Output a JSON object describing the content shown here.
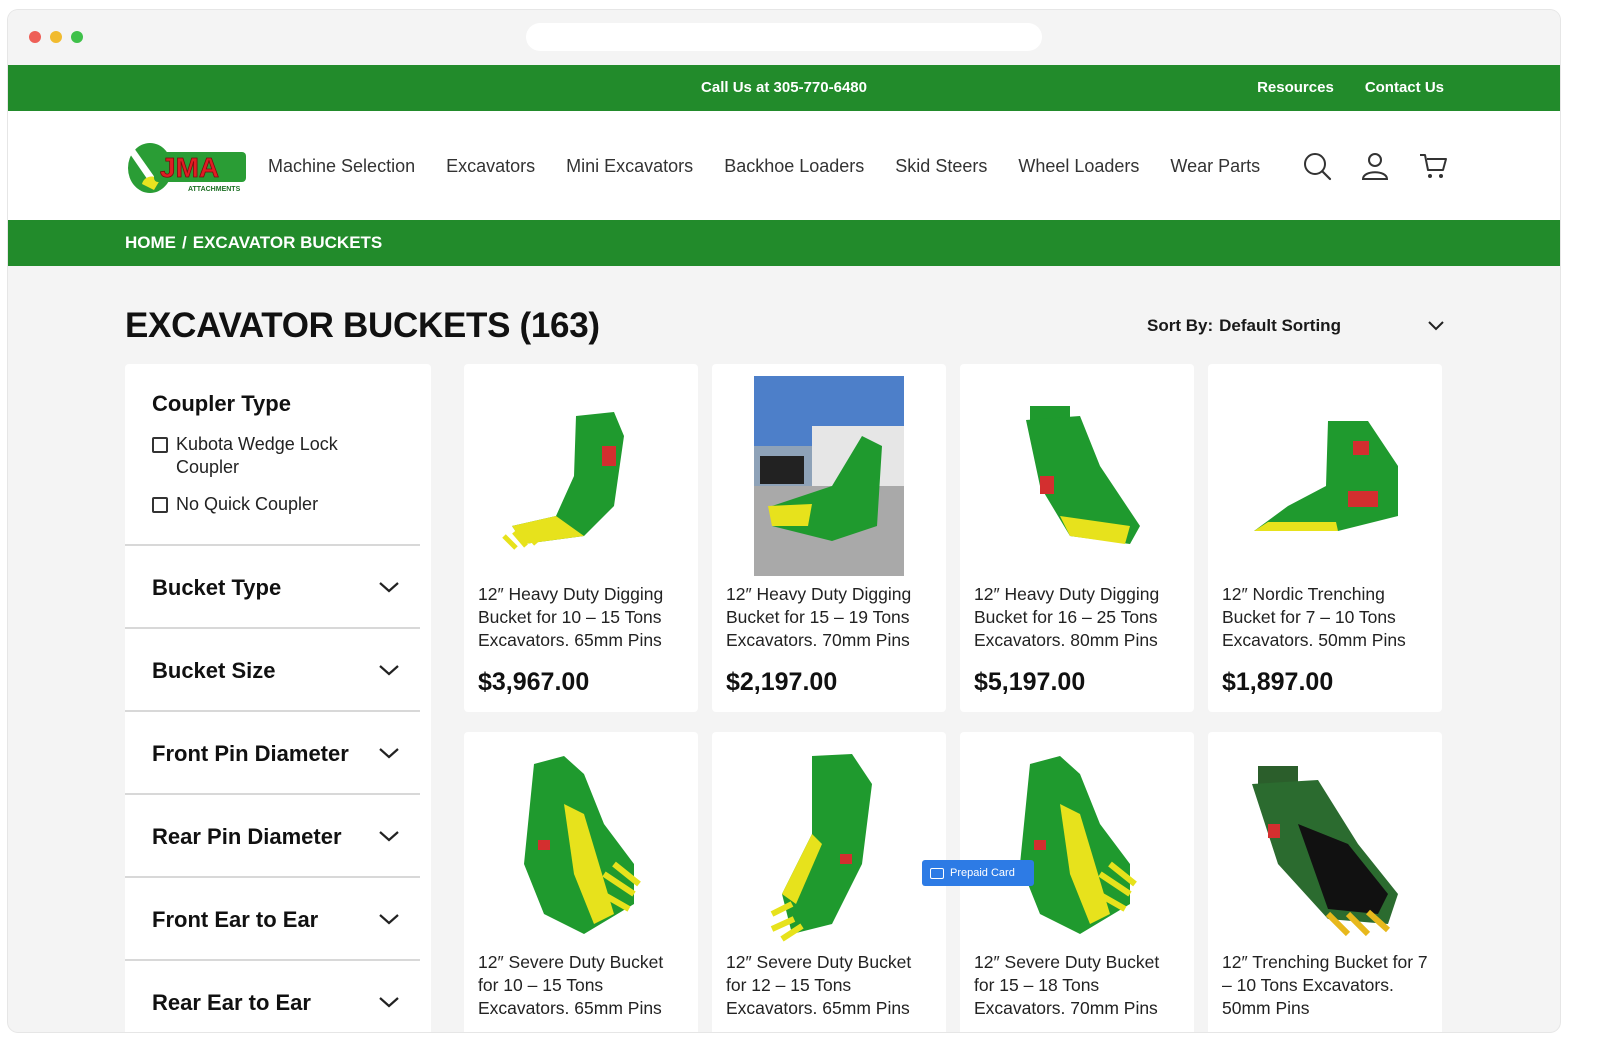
{
  "topbar": {
    "call": "Call Us at 305-770-6480",
    "links": [
      "Resources",
      "Contact Us"
    ]
  },
  "header": {
    "logo_text": "JMA",
    "logo_sub": "ATTACHMENTS",
    "nav": [
      "Machine Selection",
      "Excavators",
      "Mini Excavators",
      "Backhoe Loaders",
      "Skid Steers",
      "Wheel Loaders",
      "Wear Parts"
    ],
    "icons": [
      "search-icon",
      "user-icon",
      "cart-icon"
    ]
  },
  "breadcrumb": {
    "home": "HOME",
    "separator": "/",
    "current": "EXCAVATOR BUCKETS"
  },
  "page": {
    "title": "EXCAVATOR BUCKETS (163)",
    "sort_label": "Sort By:",
    "sort_value": "Default Sorting"
  },
  "sidebar": {
    "coupler_title": "Coupler Type",
    "coupler_options": [
      "Kubota Wedge Lock Coupler",
      "No Quick Coupler"
    ],
    "filters": [
      "Bucket Type",
      "Bucket Size",
      "Front Pin Diameter",
      "Rear Pin Diameter",
      "Front Ear to Ear",
      "Rear Ear to Ear"
    ]
  },
  "products": [
    {
      "name": "12″ Heavy Duty Digging Bucket for 10 – 15 Tons Excavators. 65mm Pins",
      "price": "$3,967.00"
    },
    {
      "name": "12″ Heavy Duty Digging Bucket for 15 – 19 Tons Excavators. 70mm Pins",
      "price": "$2,197.00"
    },
    {
      "name": "12″ Heavy Duty Digging Bucket for 16 – 25 Tons Excavators. 80mm Pins",
      "price": "$5,197.00"
    },
    {
      "name": "12″ Nordic Trenching Bucket for 7 – 10 Tons Excavators. 50mm Pins",
      "price": "$1,897.00"
    },
    {
      "name": "12″ Severe Duty Bucket for 10 – 15 Tons Excavators. 65mm Pins",
      "price": ""
    },
    {
      "name": "12″ Severe Duty Bucket for 12 – 15 Tons Excavators. 65mm Pins",
      "price": ""
    },
    {
      "name": "12″ Severe Duty Bucket for 15 – 18 Tons Excavators. 70mm Pins",
      "price": ""
    },
    {
      "name": "12″ Trenching Bucket for 7 – 10 Tons Excavators. 50mm Pins",
      "price": ""
    }
  ],
  "overlay": {
    "prepaid_label": "Prepaid Card"
  },
  "colors": {
    "brand_green": "#228b2b",
    "bucket_green": "#1f9a2e",
    "tooth_yellow": "#e7e21c",
    "overlay_blue": "#2d7be5"
  }
}
